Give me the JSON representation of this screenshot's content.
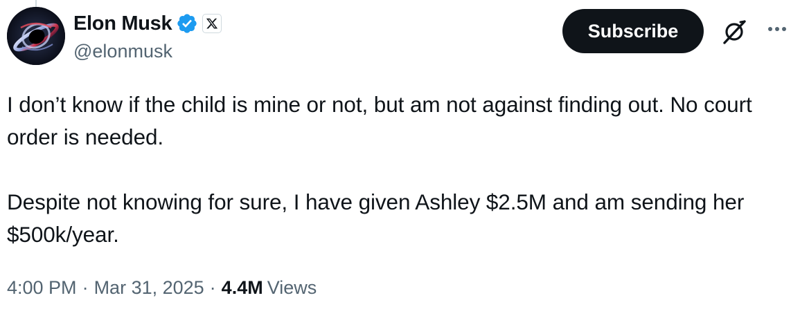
{
  "author": {
    "display_name": "Elon Musk",
    "handle": "@elonmusk",
    "verified": true,
    "affiliate_badge_icon": "x-logo-icon",
    "avatar_icon": "black-hole-avatar"
  },
  "actions": {
    "subscribe_label": "Subscribe",
    "grok_icon": "grok-icon",
    "more_icon": "more-dots-icon"
  },
  "tweet": {
    "paragraphs": [
      "I don’t know if the child is mine or not, but am not against finding out. No court order is needed.",
      "Despite not knowing for sure, I have given Ashley $2.5M and am sending her $500k/year."
    ]
  },
  "meta": {
    "time": "4:00 PM",
    "separator": "·",
    "date": "Mar 31, 2025",
    "views_count": "4.4M",
    "views_label": "Views"
  },
  "colors": {
    "text_primary": "#0f1419",
    "text_secondary": "#536471",
    "verified_blue": "#1d9bf0",
    "button_bg": "#0f1419",
    "button_text": "#ffffff"
  }
}
